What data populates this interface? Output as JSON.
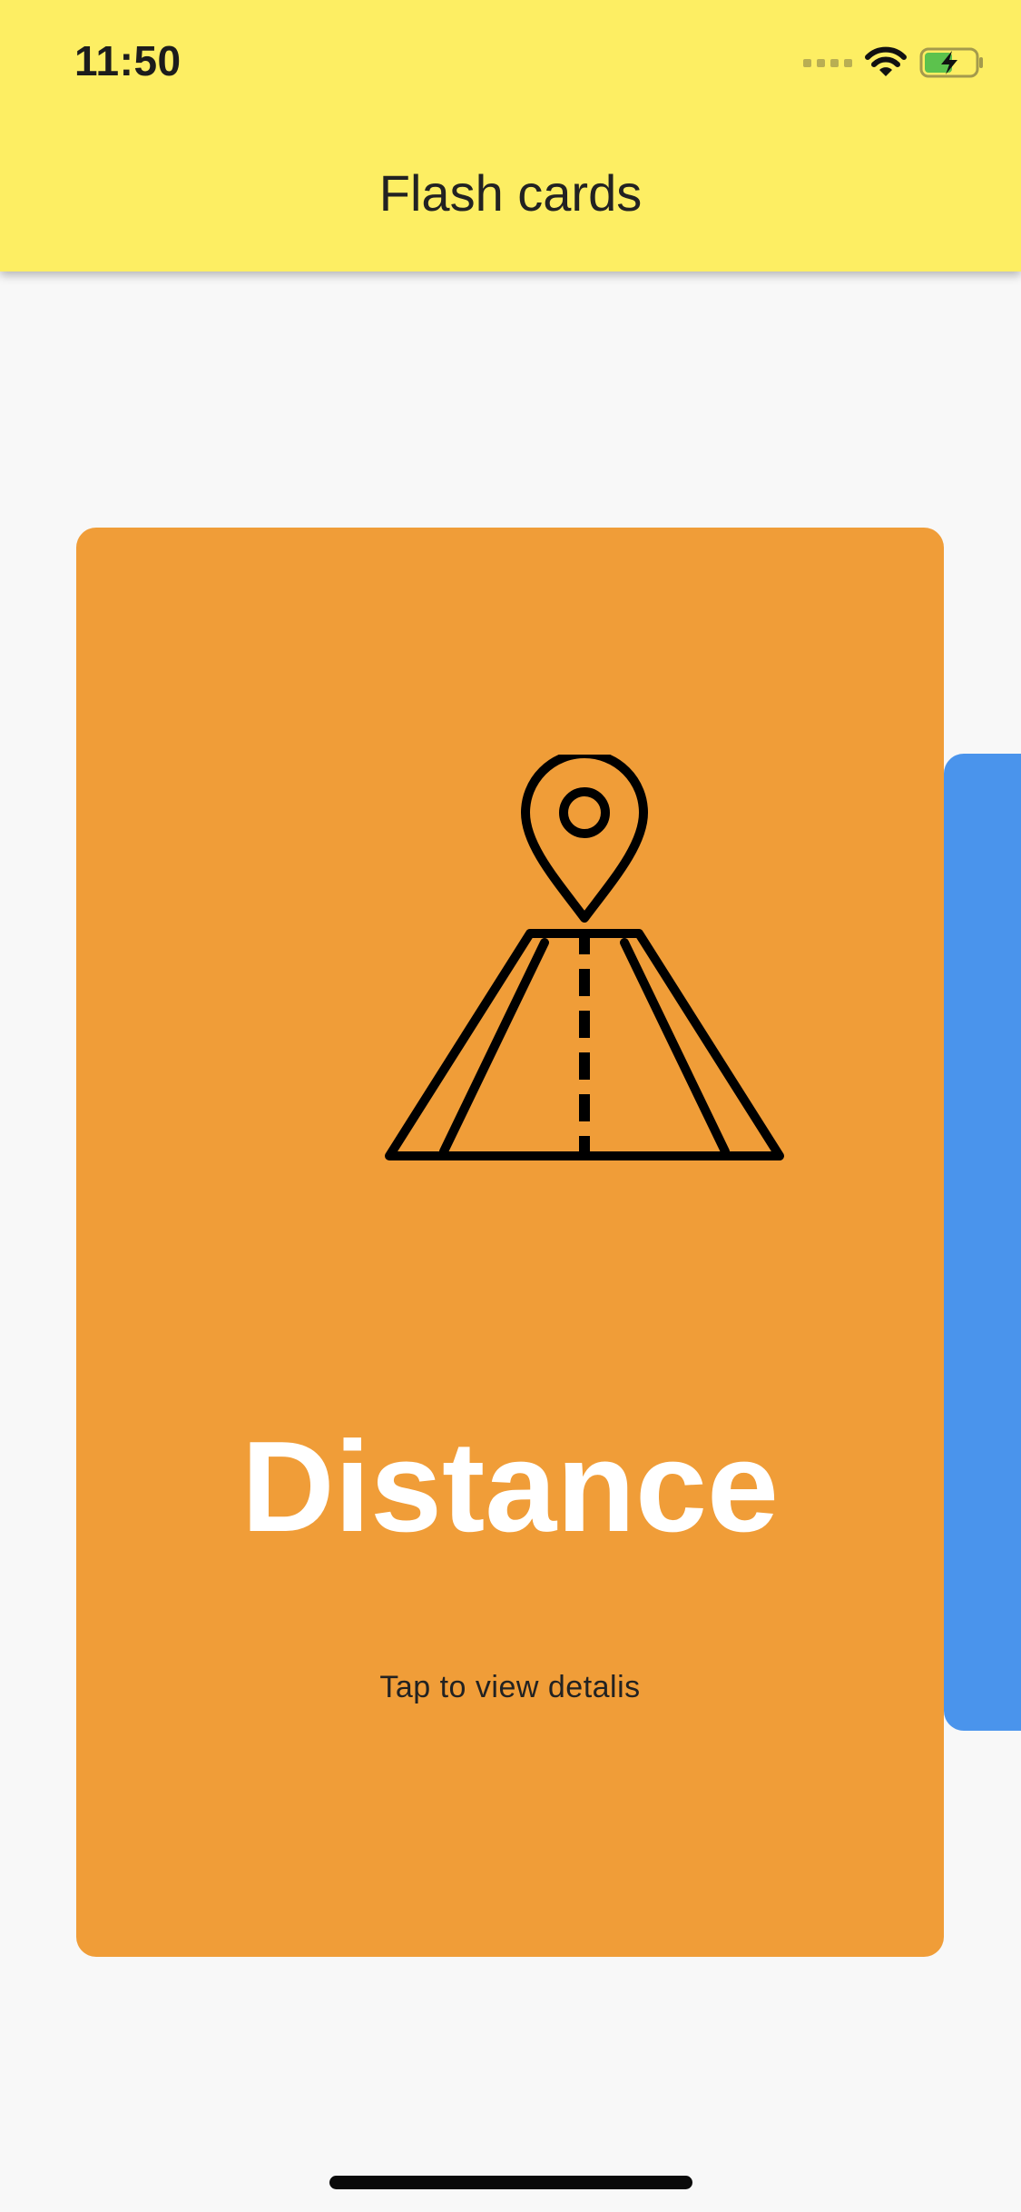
{
  "status_bar": {
    "time": "11:50",
    "icons": [
      "cellular-signal-icon",
      "wifi-icon",
      "battery-charging-icon"
    ]
  },
  "header": {
    "title": "Flash cards",
    "background_color": "#fdee63"
  },
  "cards": {
    "current": {
      "title": "Distance",
      "hint": "Tap to view detalis",
      "icon": "road-location-pin-icon",
      "color": "#f09d38"
    },
    "next": {
      "color": "#4a94ec"
    }
  }
}
